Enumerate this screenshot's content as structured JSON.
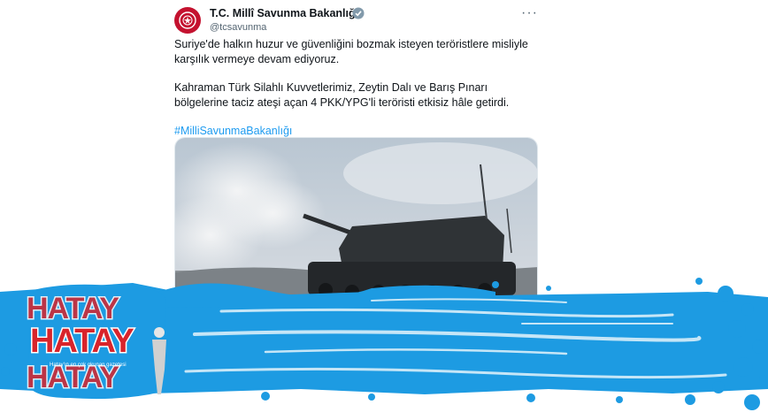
{
  "tweet": {
    "account_name": "T.C. Millî Savunma Bakanlığı",
    "handle": "@tcsavunma",
    "paragraph1": "Suriye'de halkın huzur ve güvenliğini bozmak isteyen teröristlere misliyle karşılık vermeye devam ediyoruz.",
    "paragraph2": "Kahraman Türk Silahlı Kuvvetlerimiz, Zeytin Dalı ve Barış Pınarı bölgelerine taciz ateşi açan 4 PKK/YPG'li teröristi etkisiz hâle getirdi.",
    "hashtag": "#MilliSavunmaBakanlığı",
    "icons": {
      "avatar": "ministry-emblem-icon",
      "verified": "verified-badge-icon",
      "more": "more-options-icon"
    }
  },
  "media": {
    "description_icon": "self-propelled-howitzer-photo"
  },
  "watermark": {
    "logo_text": "HATAY",
    "tagline": "Hatay'ın en çok okunan gazetesi"
  },
  "colors": {
    "brand_red": "#d8242b",
    "splash_blue": "#1d9be2",
    "link_blue": "#1d9bf0"
  }
}
